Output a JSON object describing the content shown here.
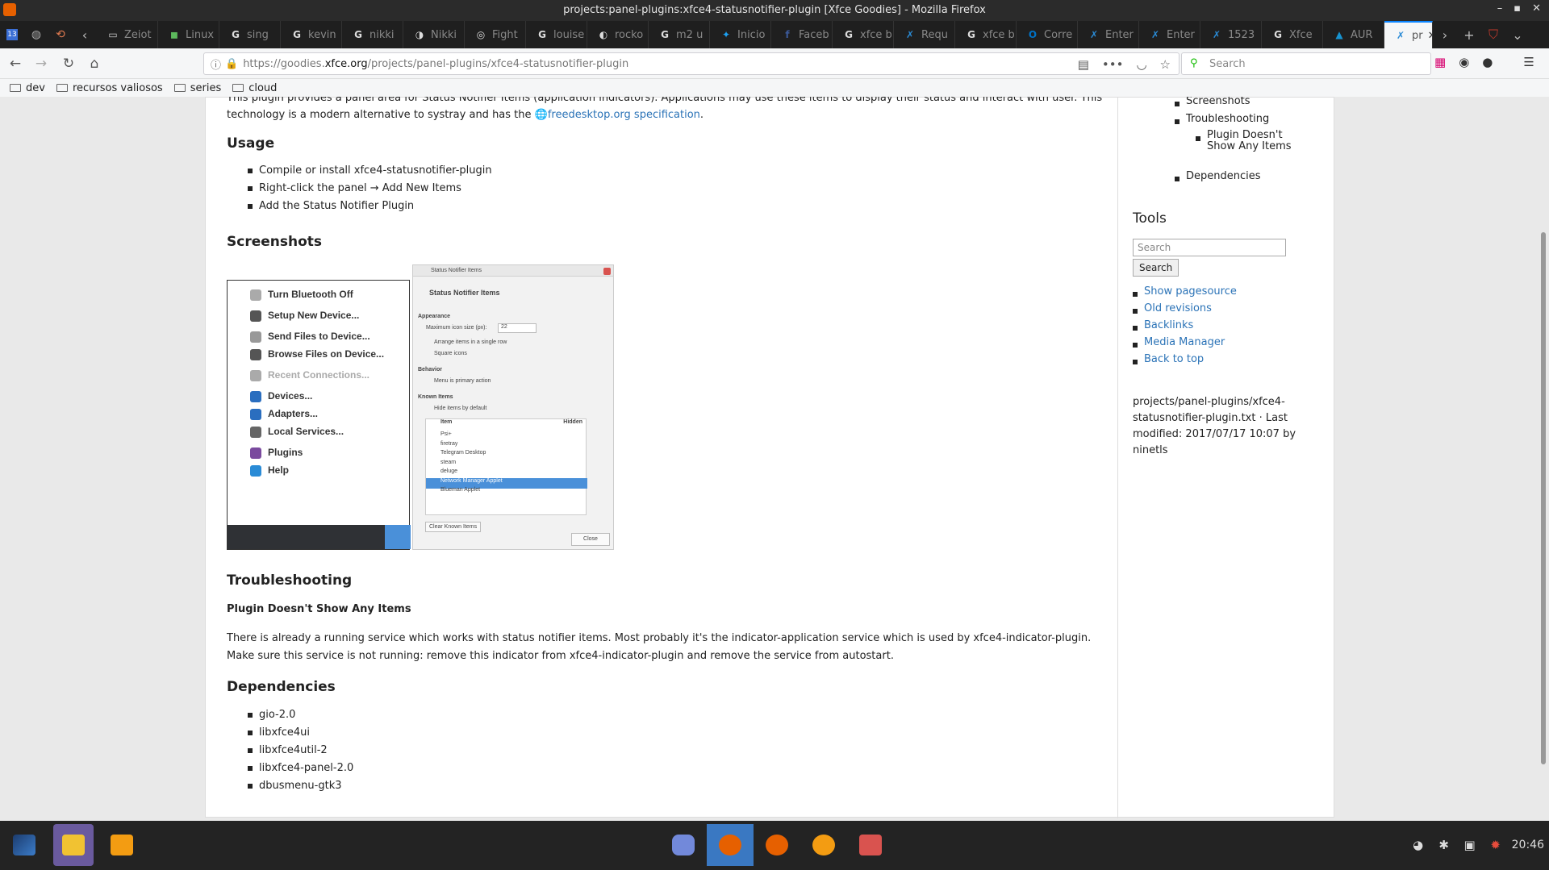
{
  "window": {
    "title": "projects:panel-plugins:xfce4-statusnotifier-plugin [Xfce Goodies] - Mozilla Firefox"
  },
  "tabs": [
    {
      "label": "Zeiot",
      "icon": "page-icon"
    },
    {
      "label": "Linux",
      "icon": "chat-icon"
    },
    {
      "label": "sing",
      "icon": "google-icon"
    },
    {
      "label": "kevin",
      "icon": "google-icon"
    },
    {
      "label": "nikki",
      "icon": "google-icon"
    },
    {
      "label": "Nikki",
      "icon": "nikki-icon"
    },
    {
      "label": "Fight",
      "icon": "circle-icon"
    },
    {
      "label": "louise",
      "icon": "google-icon"
    },
    {
      "label": "rocko",
      "icon": "github-icon"
    },
    {
      "label": "m2 u",
      "icon": "google-icon"
    },
    {
      "label": "Inicio",
      "icon": "twitter-icon"
    },
    {
      "label": "Faceb",
      "icon": "facebook-icon"
    },
    {
      "label": "xfce b",
      "icon": "google-icon"
    },
    {
      "label": "Requ",
      "icon": "xfce-icon"
    },
    {
      "label": "xfce b",
      "icon": "google-icon"
    },
    {
      "label": "Corre",
      "icon": "outlook-icon"
    },
    {
      "label": "Enter",
      "icon": "xfce-icon"
    },
    {
      "label": "Enter",
      "icon": "xfce-icon"
    },
    {
      "label": "1523",
      "icon": "xfce-icon"
    },
    {
      "label": "Xfce",
      "icon": "google-icon"
    },
    {
      "label": "AUR",
      "icon": "arch-icon"
    }
  ],
  "active_tab": {
    "label": "pr"
  },
  "navbar": {
    "url_host": "https://goodies.",
    "url_domain": "xfce.org",
    "url_path": "/projects/panel-plugins/xfce4-statusnotifier-plugin",
    "search_placeholder": "Search"
  },
  "bookmarks": [
    "dev",
    "recursos valiosos",
    "series",
    "cloud"
  ],
  "content": {
    "intro_1": "This plugin provides a panel area for Status Notifier Items (application indicators). Applications may use these items to display their status and interact with user. This",
    "intro_2": "technology is a modern alternative to systray and has the",
    "intro_link": "freedesktop.org specification",
    "intro_end": ".",
    "usage_heading": "Usage",
    "usage_items": [
      "Compile or install xfce4-statusnotifier-plugin",
      "Right-click the panel → Add New Items",
      "Add the Status Notifier Plugin"
    ],
    "screenshots_heading": "Screenshots",
    "troubleshooting_heading": "Troubleshooting",
    "trouble_sub": "Plugin Doesn't Show Any Items",
    "trouble_p1": "There is already a running service which works with status notifier items. Most probably it's the indicator-application service which is used by xfce4-indicator-plugin.",
    "trouble_p2": "Make sure this service is not running: remove this indicator from xfce4-indicator-plugin and remove the service from autostart.",
    "dependencies_heading": "Dependencies",
    "dependencies": [
      "gio-2.0",
      "libxfce4ui",
      "libxfce4util-2",
      "libxfce4-panel-2.0",
      "dbusmenu-gtk3"
    ]
  },
  "screenshot_menu": {
    "items": [
      "Turn Bluetooth Off",
      "Setup New Device...",
      "Send Files to Device...",
      "Browse Files on Device...",
      "Recent Connections...",
      "Devices...",
      "Adapters...",
      "Local Services...",
      "Plugins",
      "Help"
    ]
  },
  "screenshot_dialog": {
    "header": "Status Notifier Items",
    "title": "Status Notifier Items",
    "appearance": "Appearance",
    "max_icon_label": "Maximum icon size (px):",
    "max_icon_value": "22",
    "single_row": "Arrange items in a single row",
    "square_icons": "Square icons",
    "behavior": "Behavior",
    "menu_primary": "Menu is primary action",
    "known_items": "Known Items",
    "hide_default": "Hide items by default",
    "col_item": "Item",
    "col_hidden": "Hidden",
    "rows": [
      "Psi+",
      "firetray",
      "Telegram Desktop",
      "steam",
      "deluge",
      "Network Manager Applet",
      "Blueman Applet"
    ],
    "clear": "Clear Known Items",
    "close": "Close"
  },
  "sidebar": {
    "toc": [
      "Screenshots",
      "Troubleshooting",
      "Plugin Doesn't",
      "Show Any Items",
      "Dependencies"
    ],
    "tools_heading": "Tools",
    "search_placeholder": "Search",
    "search_button": "Search",
    "links": [
      "Show pagesource",
      "Old revisions",
      "Backlinks",
      "Media Manager",
      "Back to top"
    ],
    "meta_1": "projects/panel-plugins/xfce4-",
    "meta_2": "statusnotifier-plugin.txt · Last",
    "meta_3": "modified: 2017/07/17 10:07 by",
    "meta_4": "ninetls"
  },
  "taskbar": {
    "clock": "20:46"
  },
  "colors": {
    "link": "#2b73b7",
    "tab_accent": "#0a84ff",
    "taskbar": "#232323"
  }
}
